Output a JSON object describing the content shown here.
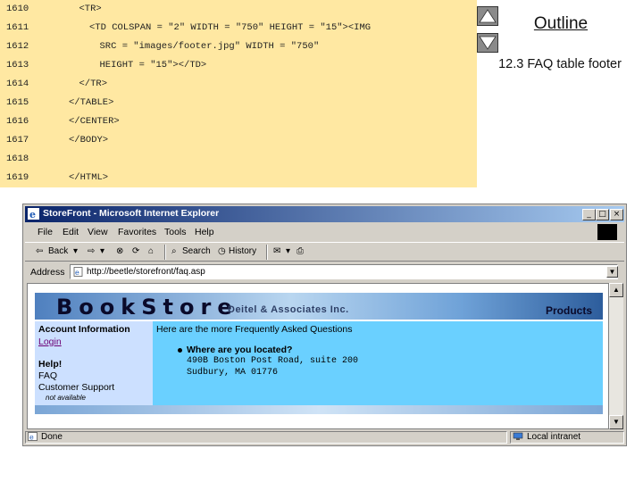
{
  "code": {
    "lines": [
      {
        "num": "1610",
        "text": "<TR>",
        "indent": 3
      },
      {
        "num": "1611",
        "text": "<TD COLSPAN = \"2\" WIDTH = \"750\" HEIGHT = \"15\"><IMG",
        "indent": 4
      },
      {
        "num": "1612",
        "text": "SRC = \"images/footer.jpg\" WIDTH = \"750\"",
        "indent": 5
      },
      {
        "num": "1613",
        "text": "HEIGHT = \"15\"></TD>",
        "indent": 5
      },
      {
        "num": "1614",
        "text": "</TR>",
        "indent": 3
      },
      {
        "num": "1615",
        "text": "</TABLE>",
        "indent": 2
      },
      {
        "num": "1616",
        "text": "</CENTER>",
        "indent": 2
      },
      {
        "num": "1617",
        "text": "</BODY>",
        "indent": 2
      },
      {
        "num": "1618",
        "text": "",
        "indent": 0
      },
      {
        "num": "1619",
        "text": "</HTML>",
        "indent": 2
      }
    ]
  },
  "outline": {
    "title": "Outline",
    "caption": "12.3 FAQ table footer"
  },
  "browser": {
    "title": "StoreFront - Microsoft Internet Explorer",
    "menu": [
      "File",
      "Edit",
      "View",
      "Favorites",
      "Tools",
      "Help"
    ],
    "toolbar": {
      "back": "Back",
      "search": "Search",
      "history": "History"
    },
    "address_label": "Address",
    "address_value": "http://beetle/storefront/faq.asp",
    "status_left": "Done",
    "status_zone": "Local intranet"
  },
  "page": {
    "logo": "BookStore",
    "company": "Deitel & Associates Inc.",
    "products": "Products",
    "sidebar": {
      "account_heading": "Account Information",
      "login": "Login",
      "help_heading": "Help!",
      "faq": "FAQ",
      "support": "Customer Support",
      "not_available": "not available"
    },
    "intro": "Here are the more Frequently Asked Questions",
    "question": "Where are you located?",
    "answer_line1": "490B Boston Post Road, suite 200",
    "answer_line2": "Sudbury, MA 01776"
  }
}
